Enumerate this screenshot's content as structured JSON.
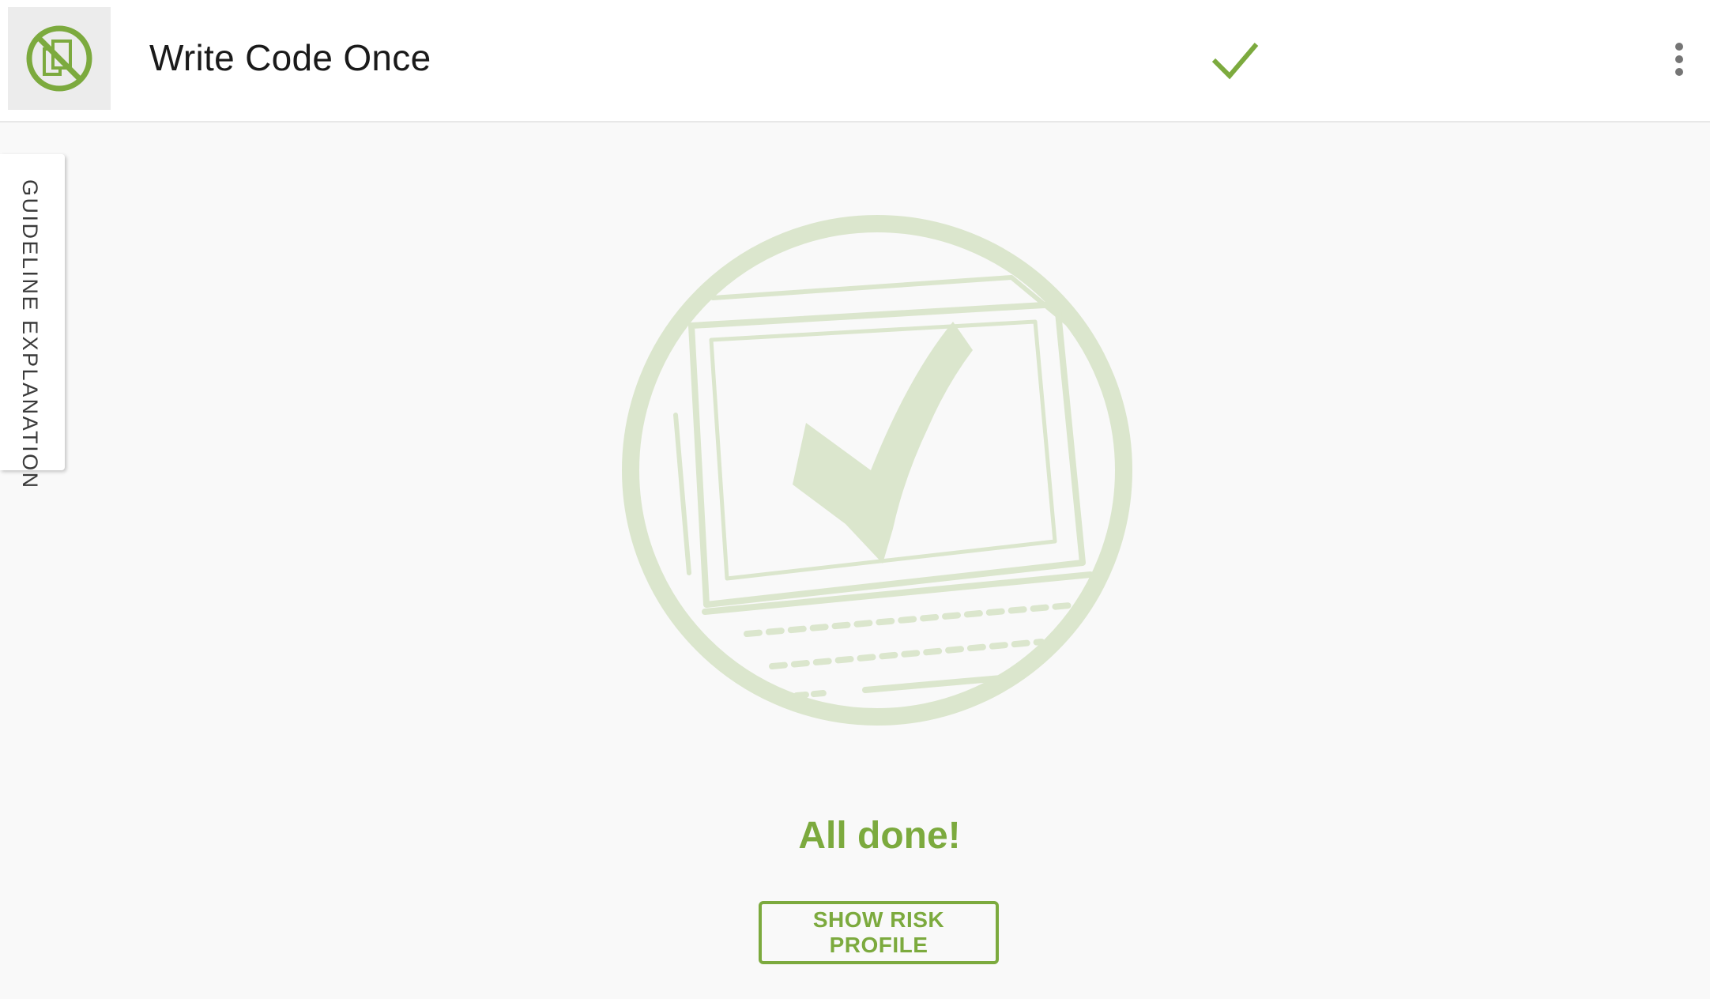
{
  "header": {
    "title": "Write Code Once",
    "logo_icon": "no-duplicate-code-icon",
    "status_icon": "checkmark-icon",
    "menu_icon": "more-vert-icon"
  },
  "side_panel": {
    "tab_label": "GUIDELINE EXPLANATION"
  },
  "main": {
    "illustration_icon": "laptop-checkmark-illustration",
    "status_message": "All done!",
    "show_risk_profile_label": "SHOW RISK PROFILE"
  },
  "colors": {
    "accent": "#7caa3e",
    "illustration": "#dbe6cd",
    "background": "#f9f9f9",
    "header_background": "#ffffff",
    "logo_background": "#ececec"
  }
}
